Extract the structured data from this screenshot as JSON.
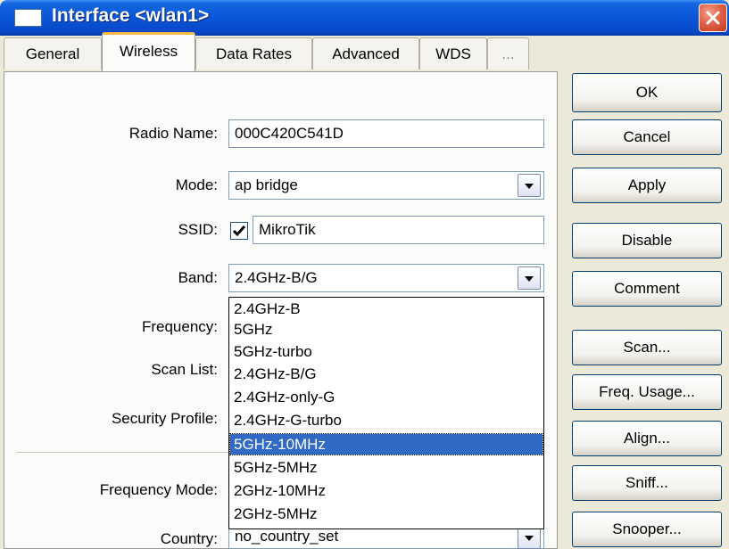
{
  "window": {
    "title": "Interface <wlan1>"
  },
  "tabs": [
    {
      "label": "General"
    },
    {
      "label": "Wireless"
    },
    {
      "label": "Data Rates"
    },
    {
      "label": "Advanced"
    },
    {
      "label": "WDS"
    },
    {
      "label": "..."
    }
  ],
  "active_tab": "Wireless",
  "form": {
    "radio_name": {
      "label": "Radio Name:",
      "value": "000C420C541D"
    },
    "mode": {
      "label": "Mode:",
      "value": "ap bridge"
    },
    "ssid": {
      "label": "SSID:",
      "checked": true,
      "value": "MikroTik"
    },
    "band": {
      "label": "Band:",
      "value": "2.4GHz-B/G"
    },
    "frequency": {
      "label": "Frequency:"
    },
    "scan_list": {
      "label": "Scan List:"
    },
    "security_profile": {
      "label": "Security Profile:"
    },
    "frequency_mode": {
      "label": "Frequency Mode:"
    },
    "country": {
      "label": "Country:",
      "value": "no_country_set"
    }
  },
  "band_dropdown": {
    "options": [
      "2.4GHz-B",
      "5GHz",
      "5GHz-turbo",
      "2.4GHz-B/G",
      "2.4GHz-only-G",
      "2.4GHz-G-turbo",
      "5GHz-10MHz",
      "5GHz-5MHz",
      "2GHz-10MHz",
      "2GHz-5MHz"
    ],
    "highlighted": "5GHz-10MHz"
  },
  "buttons": {
    "ok": "OK",
    "cancel": "Cancel",
    "apply": "Apply",
    "disable": "Disable",
    "comment": "Comment",
    "scan": "Scan...",
    "freq_usage": "Freq. Usage...",
    "align": "Align...",
    "sniff": "Sniff...",
    "snooper": "Snooper..."
  },
  "colors": {
    "titlebar": "#0a55d8",
    "selection": "#316ac5",
    "tab_highlight": "#f7b946",
    "close_button": "#e2614a"
  },
  "icons": {
    "window": "window-icon",
    "close": "close-icon",
    "checkbox": "checkmark-icon",
    "dropdown": "chevron-down-icon"
  }
}
